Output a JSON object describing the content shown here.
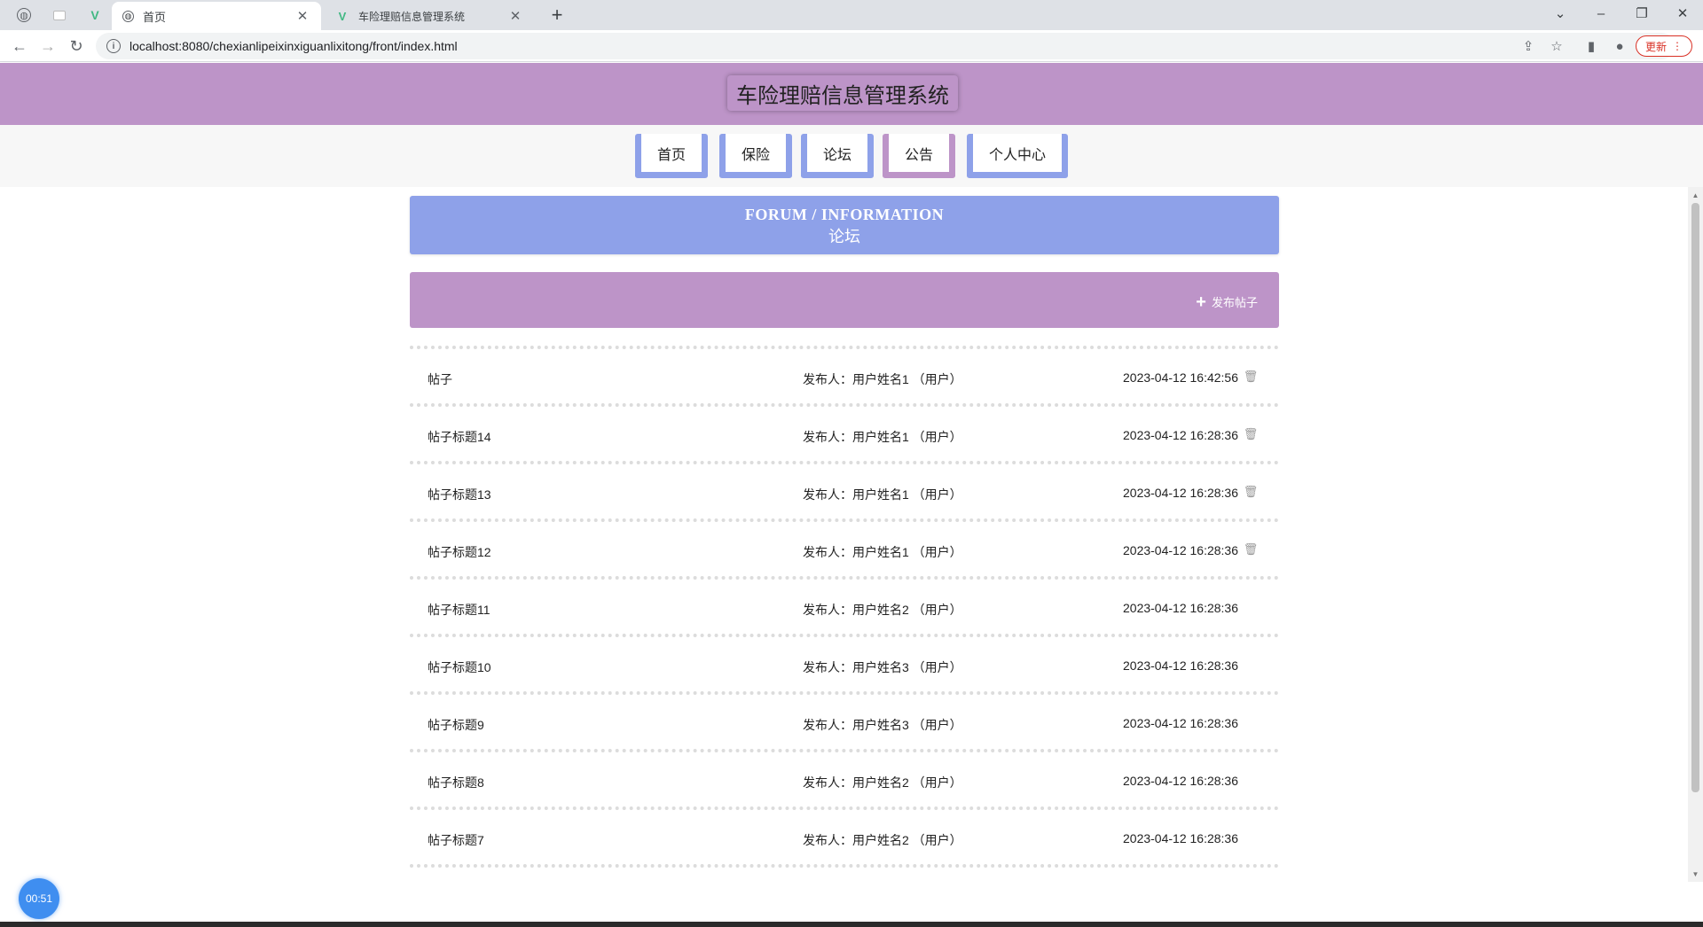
{
  "browser": {
    "tabs": [
      {
        "title": "首页",
        "icon": "globe-icon",
        "active": true
      },
      {
        "title": "车险理赔信息管理系统",
        "icon": "vue-logo-icon",
        "active": false
      }
    ],
    "url": "localhost:8080/chexianlipeixinxiguanlixitong/front/index.html",
    "update_label": "更新"
  },
  "site": {
    "title": "车险理赔信息管理系统"
  },
  "nav": {
    "items": [
      {
        "label": "首页"
      },
      {
        "label": "保险"
      },
      {
        "label": "论坛"
      },
      {
        "label": "公告",
        "active": true
      },
      {
        "label": "个人中心"
      }
    ]
  },
  "section": {
    "title_en": "FORUM / INFORMATION",
    "title_cn": "论坛"
  },
  "actions": {
    "post_label": "发布帖子"
  },
  "posts": [
    {
      "title": "帖子",
      "author": "发布人：用户姓名1 （用户）",
      "time": "2023-04-12 16:42:56",
      "deletable": true
    },
    {
      "title": "帖子标题14",
      "author": "发布人：用户姓名1 （用户）",
      "time": "2023-04-12 16:28:36",
      "deletable": true
    },
    {
      "title": "帖子标题13",
      "author": "发布人：用户姓名1 （用户）",
      "time": "2023-04-12 16:28:36",
      "deletable": true
    },
    {
      "title": "帖子标题12",
      "author": "发布人：用户姓名1 （用户）",
      "time": "2023-04-12 16:28:36",
      "deletable": true
    },
    {
      "title": "帖子标题11",
      "author": "发布人：用户姓名2 （用户）",
      "time": "2023-04-12 16:28:36",
      "deletable": false
    },
    {
      "title": "帖子标题10",
      "author": "发布人：用户姓名3 （用户）",
      "time": "2023-04-12 16:28:36",
      "deletable": false
    },
    {
      "title": "帖子标题9",
      "author": "发布人：用户姓名3 （用户）",
      "time": "2023-04-12 16:28:36",
      "deletable": false
    },
    {
      "title": "帖子标题8",
      "author": "发布人：用户姓名2 （用户）",
      "time": "2023-04-12 16:28:36",
      "deletable": false
    },
    {
      "title": "帖子标题7",
      "author": "发布人：用户姓名2 （用户）",
      "time": "2023-04-12 16:28:36",
      "deletable": false
    }
  ],
  "timer": {
    "label": "00:51"
  },
  "colors": {
    "header_purple": "#bd94c8",
    "nav_blue": "#8ea1e9"
  }
}
